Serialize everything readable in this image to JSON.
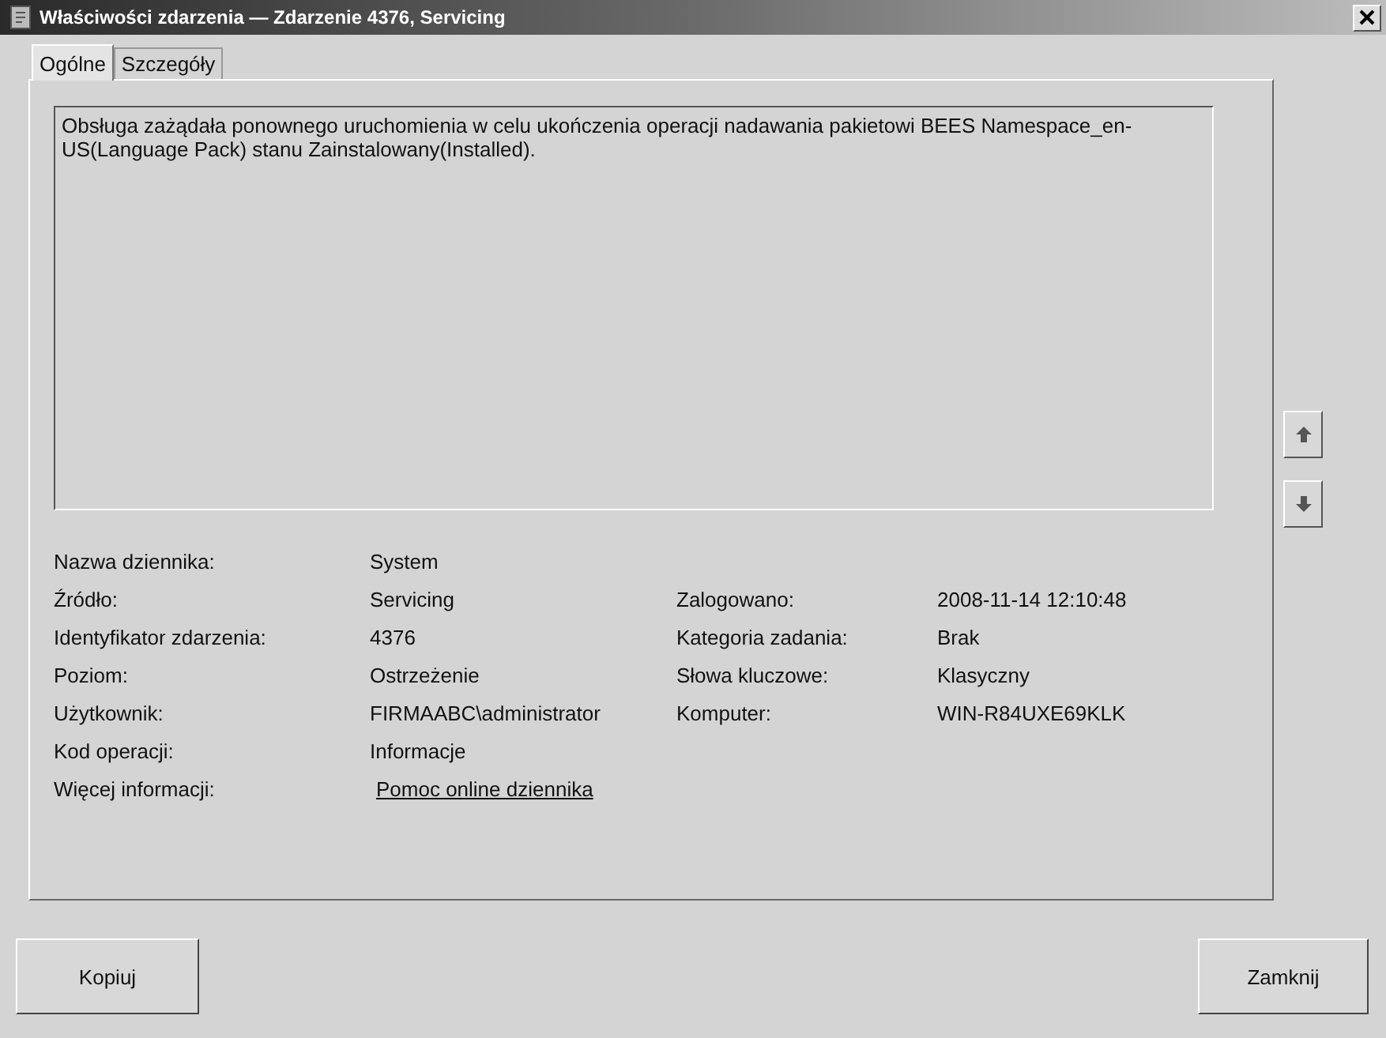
{
  "window": {
    "title": "Właściwości zdarzenia — Zdarzenie 4376, Servicing"
  },
  "tabs": [
    {
      "label": "Ogólne",
      "selected": true
    },
    {
      "label": "Szczegóły",
      "selected": false
    }
  ],
  "description": "Obsługa zażądała ponownego uruchomienia w celu ukończenia operacji nadawania pakietowi BEES Namespace_en-US(Language Pack) stanu Zainstalowany(Installed).",
  "details_left": [
    {
      "label": "Nazwa dziennika:",
      "value": "System",
      "kind": "text"
    },
    {
      "label": "Źródło:",
      "value": "Servicing",
      "kind": "text"
    },
    {
      "label": "Identyfikator zdarzenia:",
      "value": "4376",
      "kind": "text"
    },
    {
      "label": "Poziom:",
      "value": "Ostrzeżenie",
      "kind": "text"
    },
    {
      "label": "Użytkownik:",
      "value": "FIRMAABC\\administrator",
      "kind": "text"
    },
    {
      "label": "Kod operacji:",
      "value": "Informacje",
      "kind": "text"
    },
    {
      "label": "Więcej informacji:",
      "value": "Pomoc online dziennika",
      "kind": "link"
    }
  ],
  "details_right": [
    {
      "label": "Zalogowano:",
      "value": "2008-11-14 12:10:48"
    },
    {
      "label": "Kategoria zadania:",
      "value": "Brak"
    },
    {
      "label": "Słowa kluczowe:",
      "value": "Klasyczny"
    },
    {
      "label": "Komputer:",
      "value": "WIN-R84UXE69KLK"
    }
  ],
  "buttons": [
    "Kopiuj",
    "Zamknij"
  ]
}
